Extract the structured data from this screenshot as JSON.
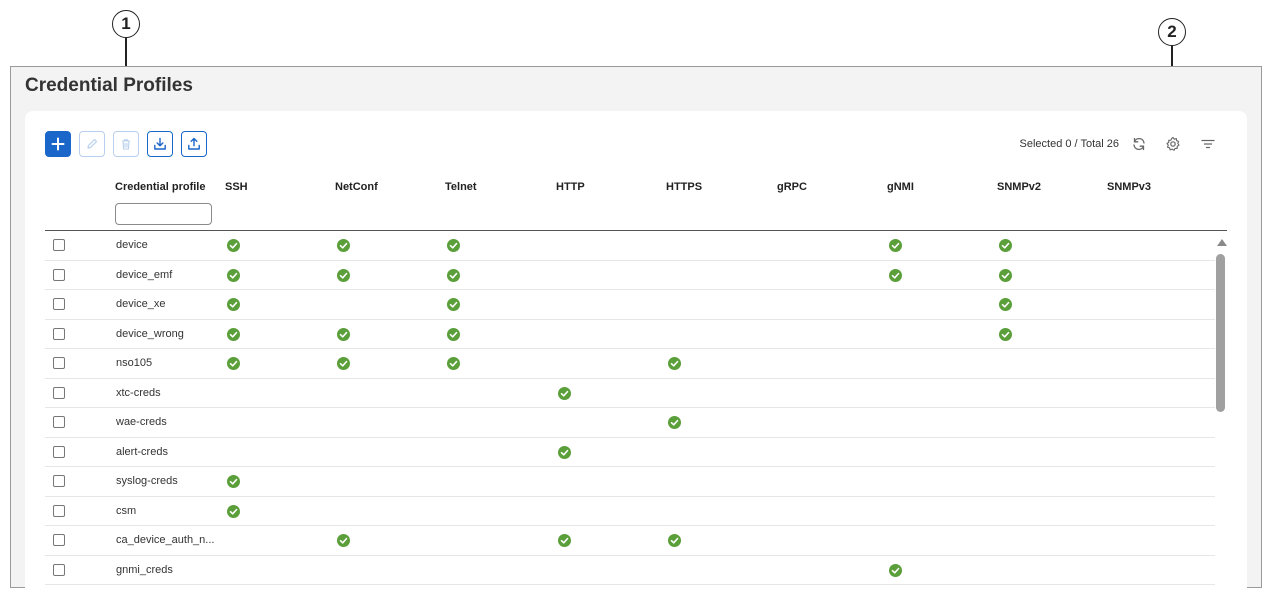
{
  "callouts": [
    "1",
    "2"
  ],
  "title": "Credential Profiles",
  "toolbar": {
    "add_icon": "plus-icon",
    "edit_icon": "pencil-icon",
    "delete_icon": "trash-icon",
    "import_icon": "download-icon",
    "export_icon": "upload-icon"
  },
  "status": {
    "selected_total": "Selected 0 / Total 26"
  },
  "right_icons": [
    "refresh-icon",
    "gear-icon",
    "filter-icon"
  ],
  "columns": [
    "Credential profile",
    "SSH",
    "NetConf",
    "Telnet",
    "HTTP",
    "HTTPS",
    "gRPC",
    "gNMI",
    "SNMPv2",
    "SNMPv3"
  ],
  "filter": {
    "value": "",
    "placeholder": ""
  },
  "check_color": "#5a9f3a",
  "accent_color": "#1a66c9",
  "rows": [
    {
      "name": "device",
      "protocols": [
        "SSH",
        "NetConf",
        "Telnet",
        "gNMI",
        "SNMPv2"
      ]
    },
    {
      "name": "device_emf",
      "protocols": [
        "SSH",
        "NetConf",
        "Telnet",
        "gNMI",
        "SNMPv2"
      ]
    },
    {
      "name": "device_xe",
      "protocols": [
        "SSH",
        "Telnet",
        "SNMPv2"
      ]
    },
    {
      "name": "device_wrong",
      "protocols": [
        "SSH",
        "NetConf",
        "Telnet",
        "SNMPv2"
      ]
    },
    {
      "name": "nso105",
      "protocols": [
        "SSH",
        "NetConf",
        "Telnet",
        "HTTPS"
      ]
    },
    {
      "name": "xtc-creds",
      "protocols": [
        "HTTP"
      ]
    },
    {
      "name": "wae-creds",
      "protocols": [
        "HTTPS"
      ]
    },
    {
      "name": "alert-creds",
      "protocols": [
        "HTTP"
      ]
    },
    {
      "name": "syslog-creds",
      "protocols": [
        "SSH"
      ]
    },
    {
      "name": "csm",
      "protocols": [
        "SSH"
      ]
    },
    {
      "name": "ca_device_auth_n...",
      "protocols": [
        "NetConf",
        "HTTP",
        "HTTPS"
      ]
    },
    {
      "name": "gnmi_creds",
      "protocols": [
        "gNMI"
      ]
    }
  ]
}
